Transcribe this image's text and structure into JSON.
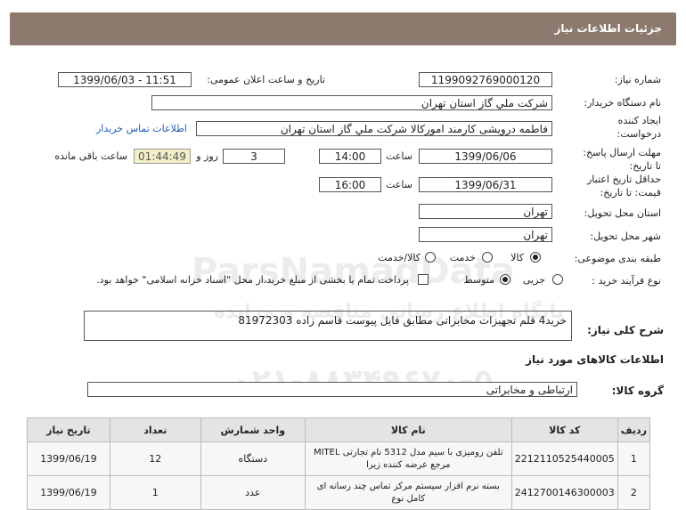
{
  "header": {
    "title": "جزئیات اطلاعات نیاز"
  },
  "form": {
    "need_number": {
      "label": "شماره نیاز:",
      "value": "1199092769000120"
    },
    "announce_datetime": {
      "label": "تاریخ و ساعت اعلان عمومی:",
      "value": "1399/06/03 - 11:51"
    },
    "buyer_org": {
      "label": "نام دستگاه خریدار:",
      "value": "شرکت ملي گاز استان تهران"
    },
    "requester": {
      "label_line1": "ایجاد کننده",
      "label_line2": "درخواست:",
      "value": "فاطمه درویشی کارمند امورکالا شرکت ملي گاز استان تهران",
      "contact_link": "اطلاعات تماس خریدار"
    },
    "response_deadline": {
      "label_line1": "مهلت ارسال پاسخ:",
      "label_line2": "تا تاریخ:",
      "date": "1399/06/06",
      "time_label": "ساعت",
      "time": "14:00",
      "days": "3",
      "days_label": "روز و",
      "remaining": "01:44:49",
      "remaining_label": "ساعت باقی مانده"
    },
    "price_validity": {
      "label_line1": "حداقل تاریخ اعتبار",
      "label_line2": "قیمت: تا تاریخ:",
      "date": "1399/06/31",
      "time_label": "ساعت",
      "time": "16:00"
    },
    "delivery_province": {
      "label": "استان محل تحویل:",
      "value": "تهران"
    },
    "delivery_city": {
      "label": "شهر محل تحویل:",
      "value": "تهران"
    },
    "category": {
      "label": "طبقه بندی موضوعی:",
      "options": [
        "کالا",
        "خدمت",
        "کالا/خدمت"
      ],
      "selected": "کالا"
    },
    "purchase_process": {
      "label": "نوع فرآیند خرید :",
      "options": [
        "جزیی",
        "متوسط"
      ],
      "selected": "متوسط",
      "payment_note": "پرداخت تمام یا بخشی از مبلغ خرید،از محل \"اسناد خزانه اسلامی\" خواهد بود."
    }
  },
  "summary": {
    "label": "شرح کلی نیاز:",
    "value": "خرید4 قلم تجهیزات مخابراتی مطابق فایل پیوست قاسم زاده 81972303"
  },
  "goods_info": {
    "title": "اطلاعات کالاهای مورد نیاز",
    "group_label": "گروه کالا:",
    "group_value": "ارتباطی و مخابراتی",
    "columns": [
      "ردیف",
      "کد کالا",
      "نام کالا",
      "واحد شمارش",
      "تعداد",
      "تاریخ نیاز"
    ],
    "rows": [
      [
        "1",
        "2212110525440005",
        "تلفن رومیزی با سیم مدل 5312 نام تجارتی MITEL مرجع عرضه کننده زیرا",
        "دستگاه",
        "12",
        "1399/06/19"
      ],
      [
        "2",
        "2412700146300003",
        "بسته نرم افزار سیستم مرکز تماس چند رسانه ای کامل نوع",
        "عدد",
        "1",
        "1399/06/19"
      ]
    ]
  },
  "watermark": {
    "line1": "ParsNamadData",
    "line2": "پایگاه اطلاع رسانی مناقصه و مزایده",
    "line3": "۰۲۱-۸۸۳۴۹۶۷۰-۵"
  }
}
